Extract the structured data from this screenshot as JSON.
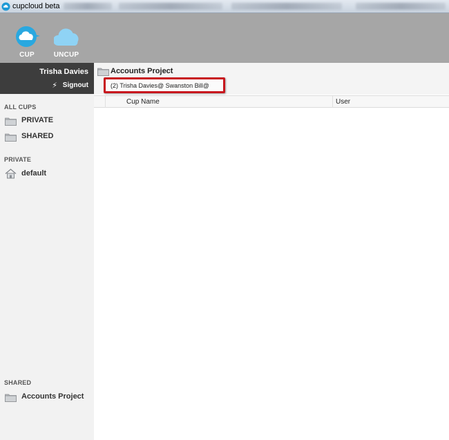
{
  "window": {
    "title": "cupcloud beta"
  },
  "toolbar": {
    "cup_label": "CUP",
    "uncup_label": "UNCUP",
    "cup_color": "#29a8e0",
    "uncup_color": "#8fd3f5"
  },
  "user": {
    "name": "Trisha Davies",
    "signout_label": "Signout"
  },
  "sidebar": {
    "all_cups": {
      "title": "ALL CUPS",
      "items": [
        {
          "label": "PRIVATE"
        },
        {
          "label": "SHARED"
        }
      ]
    },
    "private": {
      "title": "PRIVATE",
      "items": [
        {
          "label": "default"
        }
      ]
    },
    "shared": {
      "title": "SHARED",
      "items": [
        {
          "label": "Accounts Project"
        }
      ]
    }
  },
  "main": {
    "folder_title": "Accounts Project",
    "shared_with": "(2) Trisha Davies@ Swanston Bill@",
    "highlight_color": "#c8161d",
    "columns": [
      "Cup Name",
      "User"
    ]
  }
}
